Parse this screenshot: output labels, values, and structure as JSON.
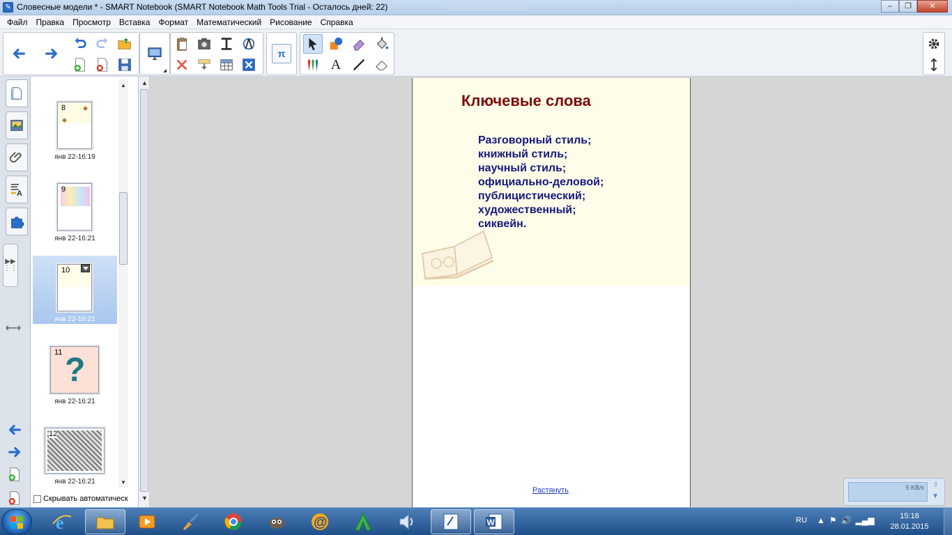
{
  "window": {
    "title": "Словесные модели * - SMART Notebook (SMART Notebook Math Tools Trial - Осталось дней: 22)",
    "minimize": "‒",
    "maximize": "❐",
    "close": "✕"
  },
  "menu": [
    "Файл",
    "Правка",
    "Просмотр",
    "Вставка",
    "Формат",
    "Математический",
    "Рисование",
    "Справка"
  ],
  "toolbar": {
    "back": "back-arrow-icon",
    "forward": "forward-arrow-icon",
    "pi_label": "π",
    "text_tool_label": "A",
    "colors": {
      "accent": "#2a6ecc",
      "selected_bg": "#cfe2f8"
    }
  },
  "sidetabs": [
    "page-sorter",
    "gallery",
    "attachments",
    "properties",
    "addons"
  ],
  "sorter": {
    "pages": [
      {
        "num": "8",
        "date": "янв 22-16:19",
        "selected": false
      },
      {
        "num": "9",
        "date": "янв 22-16:21",
        "selected": false
      },
      {
        "num": "10",
        "date": "янв 22-16:21",
        "selected": true
      },
      {
        "num": "11",
        "date": "янв 22-16:21",
        "selected": false,
        "glyph": "?"
      },
      {
        "num": "12",
        "date": "янв 22-16:21",
        "selected": false
      }
    ],
    "autohide_label": "Скрывать автоматическ"
  },
  "slide": {
    "title": "Ключевые слова",
    "items": [
      "Разговорный стиль;",
      "книжный стиль;",
      "научный стиль;",
      "официально-деловой;",
      "публицистический;",
      "художественный;",
      "сиквейн."
    ],
    "stretch_link": "Растянуть",
    "colors": {
      "title": "#7a0c0c",
      "text": "#17177e",
      "background": "#fefde9"
    }
  },
  "netwidget": {
    "speed": "5 KB/s"
  },
  "taskbar": {
    "lang": "RU",
    "time": "15:18",
    "date": "28.01.2015"
  }
}
